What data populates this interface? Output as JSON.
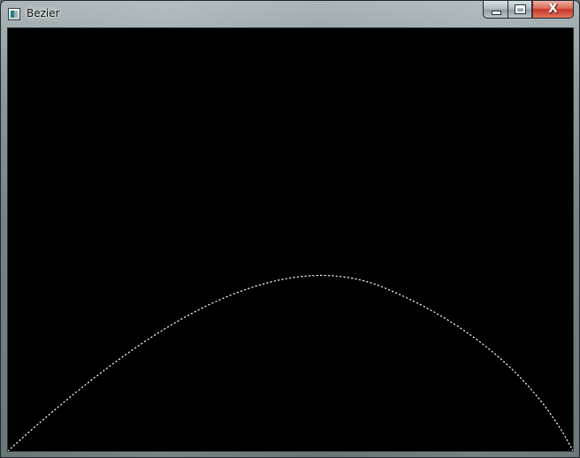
{
  "window": {
    "title": "Bezier",
    "icon": "application-window-icon",
    "controls": {
      "minimize": "minimize-icon",
      "maximize": "maximize-icon",
      "close_label": "X"
    }
  },
  "canvas": {
    "background": "#000000",
    "curve_color": "#ffffff",
    "curve_style": "dotted"
  }
}
